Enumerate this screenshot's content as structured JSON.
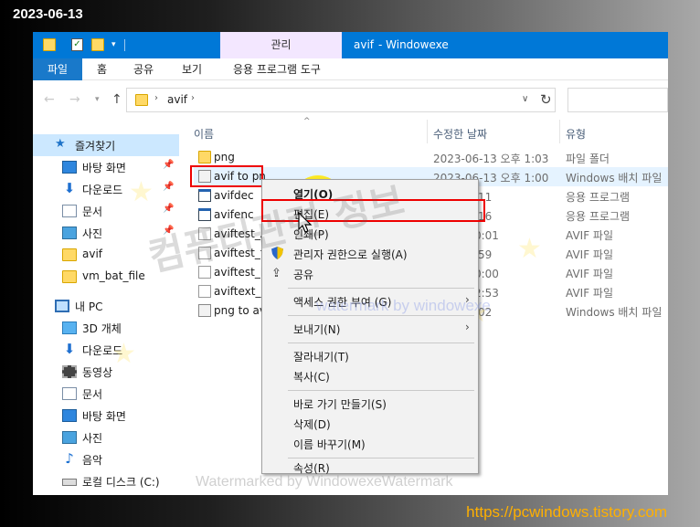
{
  "caption": {
    "date": "2023-06-13",
    "site_url": "https://pcwindows.tistory.com"
  },
  "titlebar": {
    "manage_tab": "관리",
    "folder_name": "avif",
    "app_name": "- Windowexe",
    "accent_color": "#0078d7",
    "manage_tab_color": "#f3e7ff"
  },
  "ribbon": {
    "tabs": [
      "파일",
      "홈",
      "공유",
      "보기",
      "응용 프로그램 도구"
    ],
    "file_tab_color": "#1979ca"
  },
  "address_bar": {
    "path": "avif",
    "icons": [
      "back-arrow-icon",
      "forward-arrow-icon",
      "recent-dropdown-icon",
      "up-arrow-icon",
      "refresh-icon"
    ]
  },
  "nav_pane": {
    "items": [
      {
        "label": "즐겨찾기",
        "icon": "star-icon"
      },
      {
        "label": "바탕 화면",
        "icon": "desktop-icon",
        "pinned": true
      },
      {
        "label": "다운로드",
        "icon": "download-icon",
        "pinned": true
      },
      {
        "label": "문서",
        "icon": "document-icon",
        "pinned": true
      },
      {
        "label": "사진",
        "icon": "pictures-icon",
        "pinned": true
      },
      {
        "label": "avif",
        "icon": "folder-icon"
      },
      {
        "label": "vm_bat_file",
        "icon": "folder-icon"
      },
      {
        "label": "내 PC",
        "icon": "pc-icon"
      },
      {
        "label": "3D 개체",
        "icon": "3d-objects-icon"
      },
      {
        "label": "다운로드",
        "icon": "download-icon"
      },
      {
        "label": "동영상",
        "icon": "video-icon"
      },
      {
        "label": "문서",
        "icon": "document-icon"
      },
      {
        "label": "바탕 화면",
        "icon": "desktop-icon"
      },
      {
        "label": "사진",
        "icon": "pictures-icon"
      },
      {
        "label": "음악",
        "icon": "music-icon"
      },
      {
        "label": "로컬 디스크 (C:)",
        "icon": "drive-icon"
      }
    ]
  },
  "file_list": {
    "headers": {
      "name": "이름",
      "date": "수정한 날짜",
      "type": "유형"
    },
    "rows": [
      {
        "name": "png",
        "date": "2023-06-13 오후 1:03",
        "type": "파일 폴더",
        "icon": "folder-icon"
      },
      {
        "name": "avif to pn",
        "date": "2023-06-13 오후 1:00",
        "type": "Windows 배치 파일",
        "icon": "batch-file-icon",
        "selected": true
      },
      {
        "name": "avifdec",
        "date": "2 오후 8:11",
        "type": "응용 프로그램",
        "icon": "exe-icon"
      },
      {
        "name": "avifenc",
        "date": "2 오후 8:16",
        "type": "응용 프로그램",
        "icon": "exe-icon"
      },
      {
        "name": "aviftest_A",
        "date": "3 오전 10:01",
        "type": "AVIF 파일",
        "icon": "file-icon"
      },
      {
        "name": "aviftest_fc",
        "date": "3 오전 9:59",
        "type": "AVIF 파일",
        "icon": "file-icon"
      },
      {
        "name": "aviftest_h",
        "date": "3 오전 10:00",
        "type": "AVIF 파일",
        "icon": "file-icon"
      },
      {
        "name": "aviftext_k",
        "date": "3 오후 12:53",
        "type": "AVIF 파일",
        "icon": "file-icon"
      },
      {
        "name": "png to av",
        "date": "3 오후 1:02",
        "type": "Windows 배치 파일",
        "icon": "batch-file-icon"
      }
    ]
  },
  "context_menu": {
    "items": [
      {
        "label": "열기(O)"
      },
      {
        "label": "편집(E)"
      },
      {
        "label": "인쇄(P)"
      },
      {
        "label": "관리자 권한으로 실행(A)",
        "icon": "uac-shield-icon"
      },
      {
        "label": "공유",
        "icon": "share-icon"
      },
      {
        "label": "액세스 권한 부여 (G)",
        "submenu": true
      },
      {
        "label": "보내기(N)",
        "submenu": true
      },
      {
        "label": "잘라내기(T)"
      },
      {
        "label": "복사(C)"
      },
      {
        "label": "바로 가기 만들기(S)"
      },
      {
        "label": "삭제(D)"
      },
      {
        "label": "이름 바꾸기(M)"
      },
      {
        "label": "속성(R)"
      }
    ]
  },
  "highlight_color": "#ee0000",
  "watermarks": {
    "korean": "컴퓨터관련 정보",
    "blue": "watermark by windowexe",
    "bottom": "Watermarked by WindowexeWatermark"
  }
}
